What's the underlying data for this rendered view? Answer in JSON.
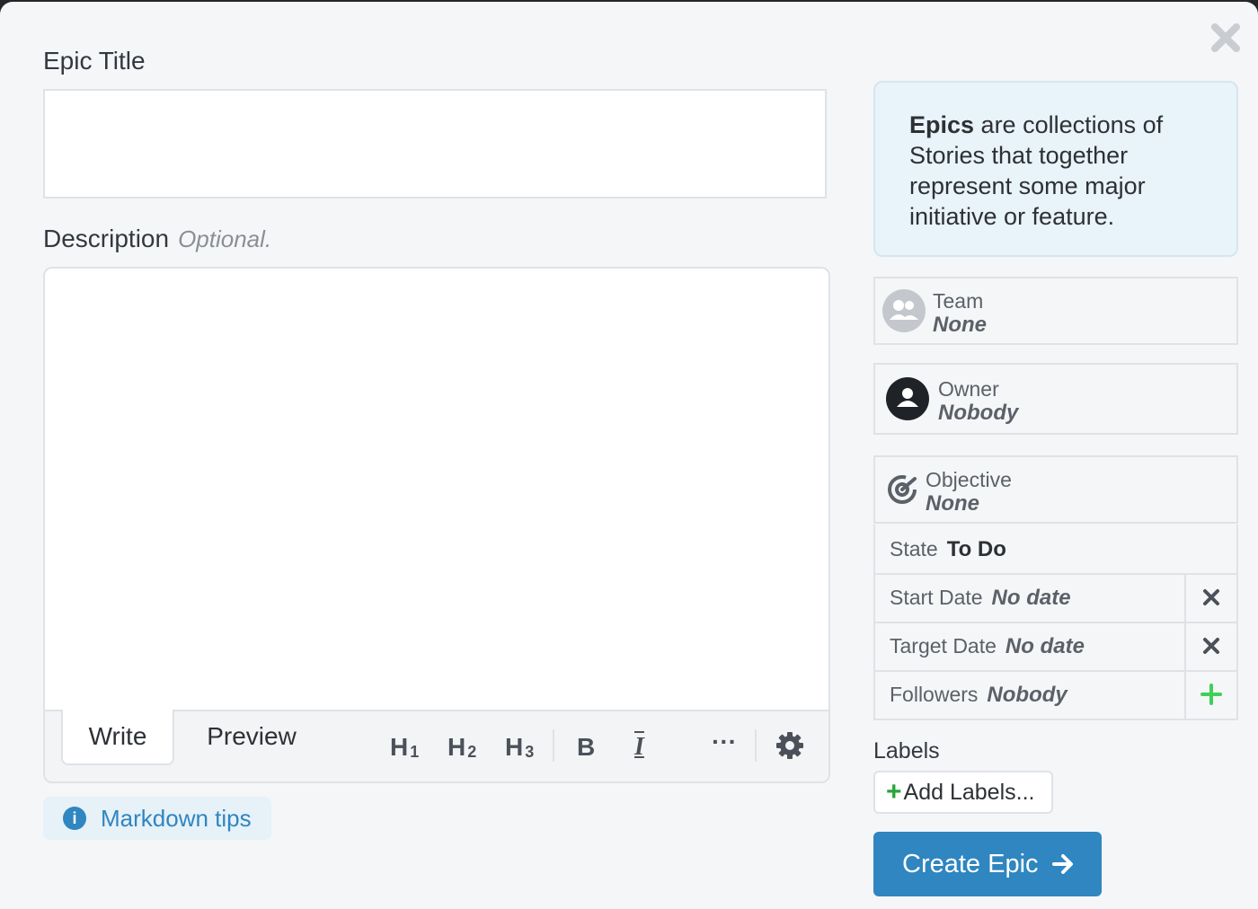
{
  "form": {
    "title_label": "Epic Title",
    "title_value": "",
    "description_label": "Description",
    "description_optional": "Optional.",
    "description_value": ""
  },
  "editor": {
    "tab_write": "Write",
    "tab_preview": "Preview",
    "h1": "H",
    "h1_sub": "1",
    "h2": "H",
    "h2_sub": "2",
    "h3": "H",
    "h3_sub": "3",
    "bold": "B",
    "italic": "I",
    "more": "···"
  },
  "markdown_tips": "Markdown tips",
  "info": {
    "bold": "Epics",
    "text": " are collections of Stories that together represent some major initiative or feature."
  },
  "fields": {
    "team": {
      "label": "Team",
      "value": "None"
    },
    "owner": {
      "label": "Owner",
      "value": "Nobody"
    },
    "objective": {
      "label": "Objective",
      "value": "None"
    },
    "state": {
      "label": "State",
      "value": "To Do"
    },
    "start_date": {
      "label": "Start Date",
      "value": "No date"
    },
    "target_date": {
      "label": "Target Date",
      "value": "No date"
    },
    "followers": {
      "label": "Followers",
      "value": "Nobody"
    }
  },
  "labels": {
    "heading": "Labels",
    "add_button": "Add Labels..."
  },
  "create_button": "Create Epic",
  "colors": {
    "accent": "#2f86c0",
    "green": "#27a537",
    "text": "#2d3136",
    "muted": "#5b6168"
  },
  "icons": [
    "close-icon",
    "team-icon",
    "owner-avatar-icon",
    "objective-target-icon",
    "clear-x-icon",
    "add-plus-icon",
    "info-icon",
    "settings-gear-icon",
    "arrow-right-icon"
  ]
}
